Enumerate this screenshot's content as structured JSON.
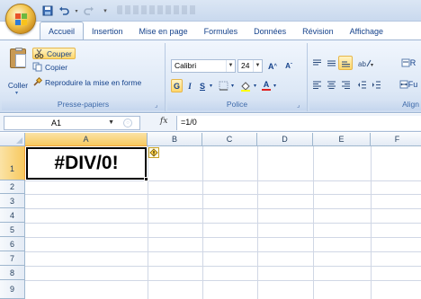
{
  "colors": {
    "accent": "#15428b",
    "selection": "#f7c95f",
    "ribbon": "#dde8f6"
  },
  "tabs": [
    "Accueil",
    "Insertion",
    "Mise en page",
    "Formules",
    "Données",
    "Révision",
    "Affichage"
  ],
  "clipboard": {
    "paste_label": "Coller",
    "cut_label": "Couper",
    "copy_label": "Copier",
    "format_painter_label": "Reproduire la mise en forme",
    "group_label": "Presse-papiers"
  },
  "font": {
    "name": "Calibri",
    "size": "24",
    "grow_label": "A",
    "shrink_label": "A",
    "bold": "G",
    "italic": "I",
    "underline": "S",
    "color_letter": "A",
    "group_label": "Police"
  },
  "alignment": {
    "group_label": "Align"
  },
  "wrap": {
    "r_label": "R",
    "fu_label": "Fu"
  },
  "formula_bar": {
    "name_box": "A1",
    "fx": "fx",
    "formula": "=1/0"
  },
  "sheet": {
    "columns": [
      "A",
      "B",
      "C",
      "D",
      "E",
      "F"
    ],
    "rows": [
      "1",
      "2",
      "3",
      "4",
      "5",
      "6",
      "7",
      "8",
      "9"
    ],
    "a1_value": "#DIV/0!"
  },
  "icons": [
    "office-logo-icon",
    "save-icon",
    "undo-icon",
    "redo-icon",
    "scissors-icon",
    "copy-icon",
    "brush-icon",
    "error-smart-tag-icon"
  ]
}
